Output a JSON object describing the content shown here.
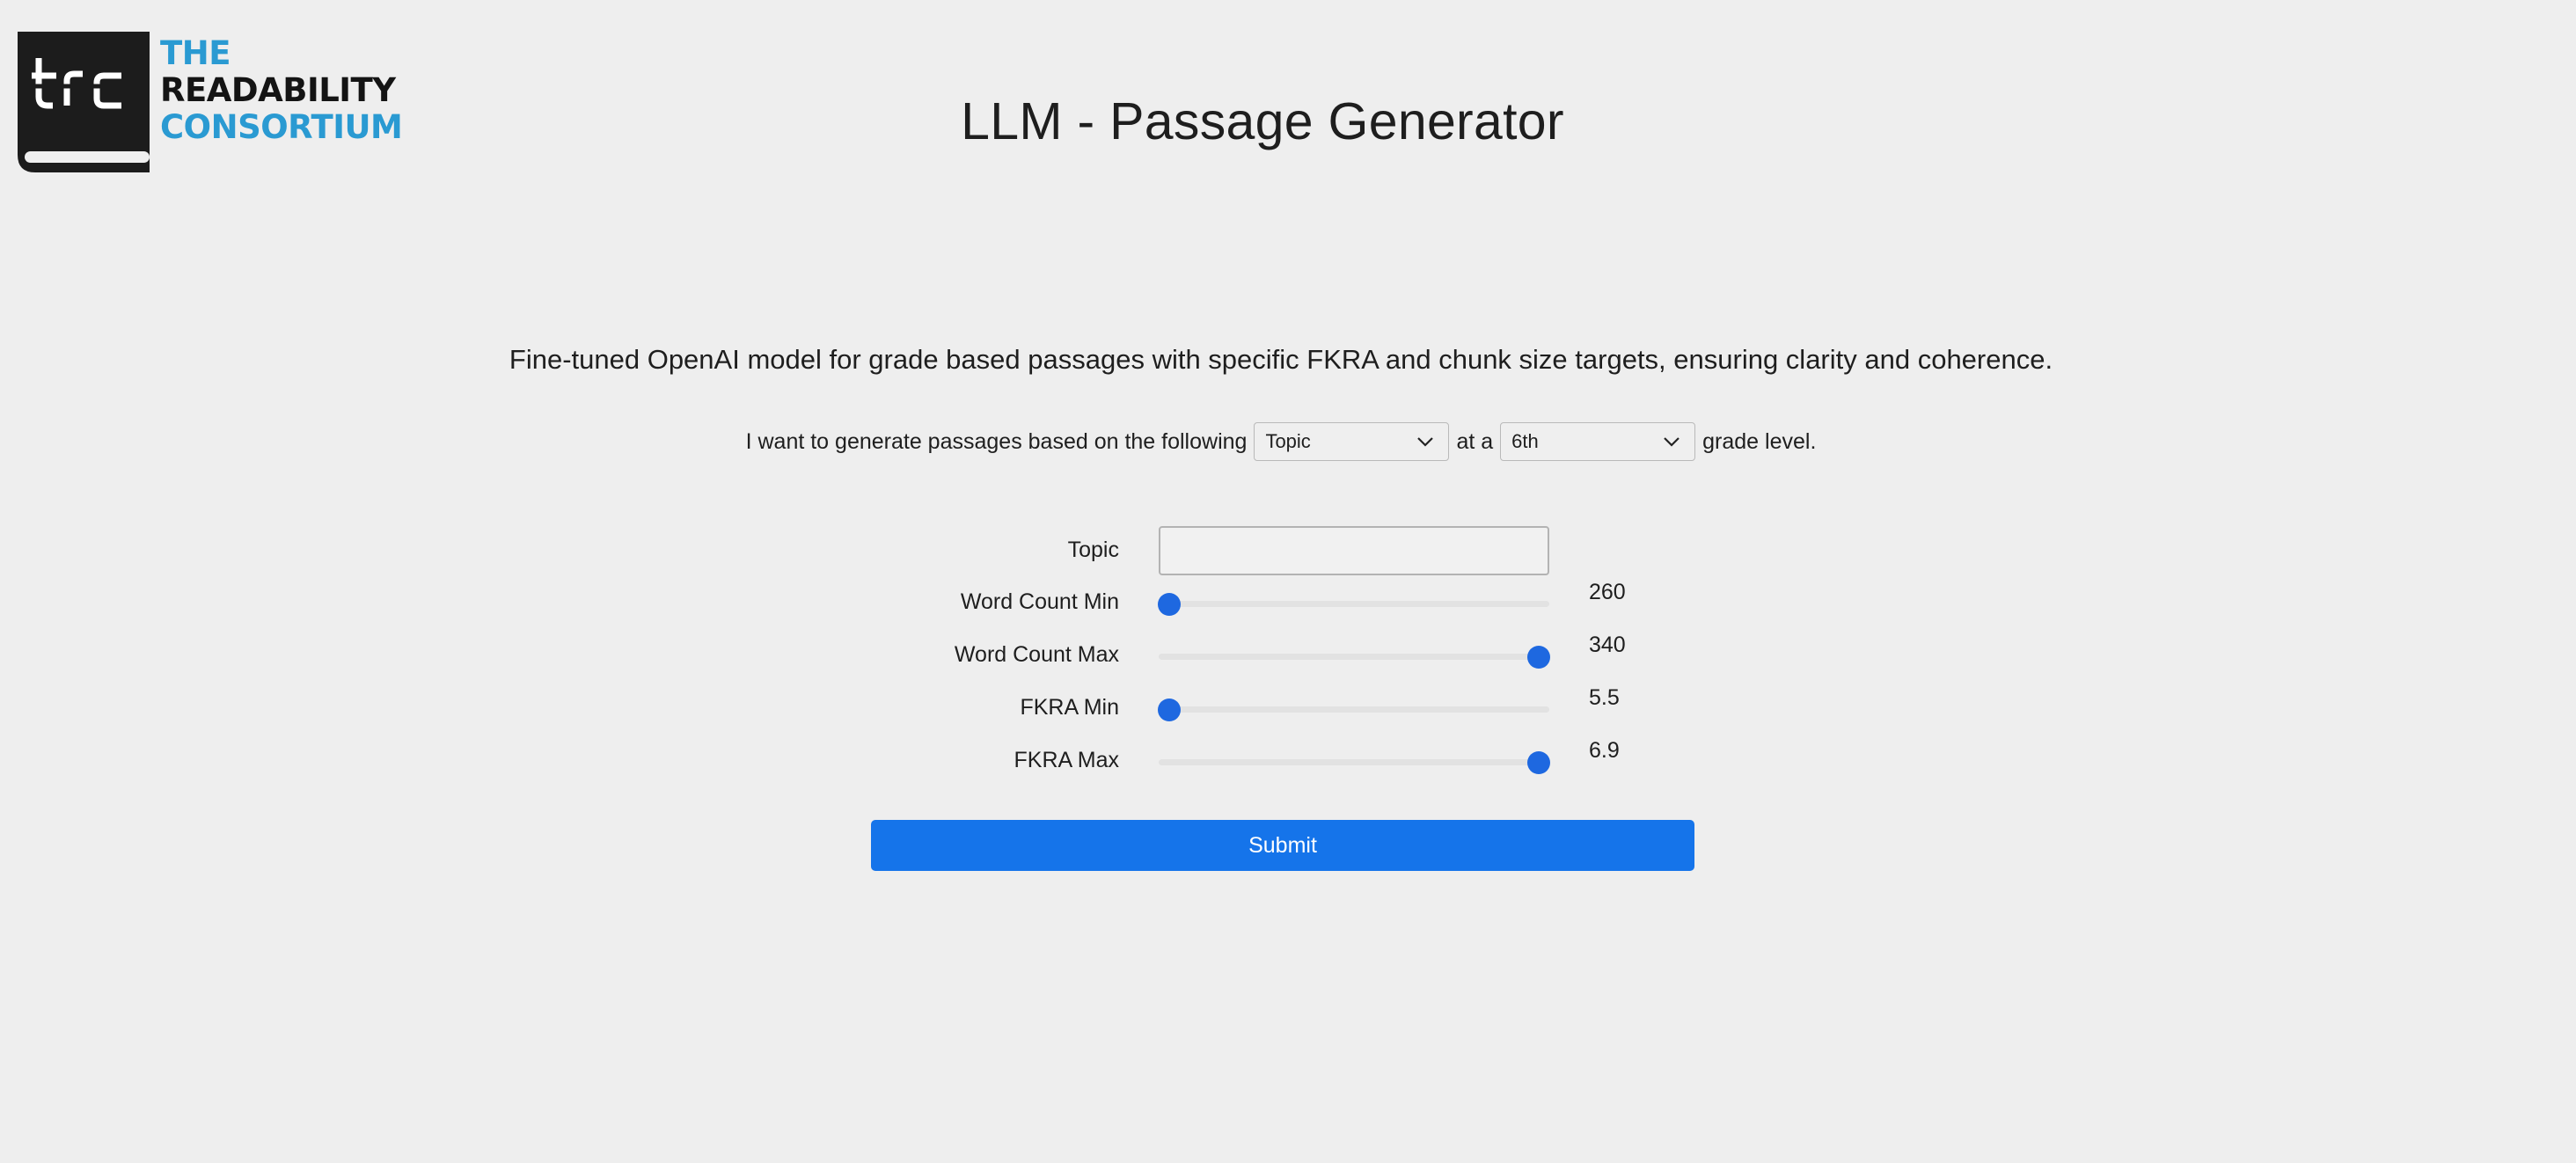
{
  "logo": {
    "mark_text": "trc",
    "line1": "THE",
    "line2": "READABILITY",
    "line3": "CONSORTIUM",
    "colors": {
      "blue": "#2a9ad2",
      "black": "#141414"
    }
  },
  "header": {
    "title": "LLM - Passage Generator"
  },
  "description": "Fine-tuned OpenAI model for grade based passages with specific FKRA and chunk size targets, ensuring clarity and coherence.",
  "sentence": {
    "prefix": "I want to generate passages based on the following",
    "source_select": {
      "value": "Topic",
      "icon": "chevron-down-icon"
    },
    "middle": "at a",
    "grade_select": {
      "value": "6th",
      "icon": "chevron-down-icon"
    },
    "suffix": "grade level."
  },
  "form": {
    "topic": {
      "label": "Topic",
      "value": "",
      "placeholder": ""
    },
    "word_count_min": {
      "label": "Word Count Min",
      "value": "260",
      "level": 0.0
    },
    "word_count_max": {
      "label": "Word Count Max",
      "value": "340",
      "level": 1.0
    },
    "fkra_min": {
      "label": "FKRA Min",
      "value": "5.5",
      "level": 0.0
    },
    "fkra_max": {
      "label": "FKRA Max",
      "value": "6.9",
      "level": 1.0
    }
  },
  "submit_label": "Submit",
  "colors": {
    "background": "#eeeeee",
    "accent": "#1574ea",
    "slider_thumb": "#1e68e0"
  }
}
